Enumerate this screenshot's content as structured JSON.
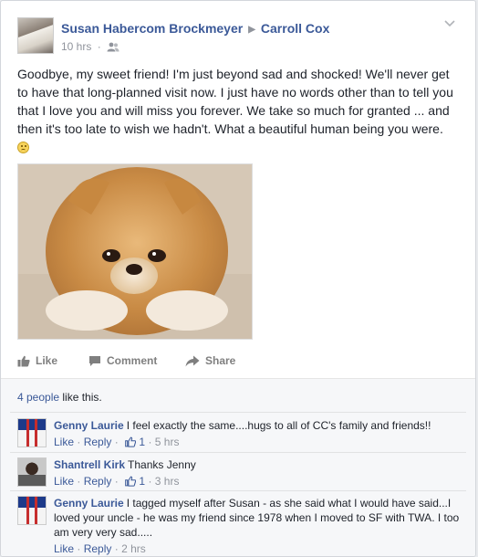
{
  "post": {
    "author": "Susan Habercom Brockmeyer",
    "target": "Carroll Cox",
    "time": "10 hrs",
    "separator": "·",
    "text": "Goodbye, my sweet friend! I'm just beyond sad and shocked! We'll never get to have that long-planned visit now. I just have no words other than to tell you that I love you and will miss you forever. We take so much for granted ... and then it's too late to wish we hadn't. What a beautiful human being you were."
  },
  "actions": {
    "like": "Like",
    "comment": "Comment",
    "share": "Share"
  },
  "likes": {
    "count_link": "4 people",
    "suffix": " like this."
  },
  "comments": [
    {
      "author": "Genny Laurie",
      "text": "I feel exactly the same....hugs to all of CC's family and friends!!",
      "like": "Like",
      "reply": "Reply",
      "likes_count": "1",
      "time": "5 hrs"
    },
    {
      "author": "Shantrell Kirk",
      "text": "Thanks Jenny",
      "like": "Like",
      "reply": "Reply",
      "likes_count": "1",
      "time": "3 hrs"
    },
    {
      "author": "Genny Laurie",
      "text": "I tagged myself after Susan - as she said what I would have said...I loved your uncle - he was my friend since 1978 when I moved to SF with TWA. I too am very very sad.....",
      "like": "Like",
      "reply": "Reply",
      "time": "2 hrs"
    }
  ],
  "meta_separator": "·",
  "colors": {
    "link": "#3b5998",
    "muted": "#90949c",
    "feedback_bg": "#f6f7f9"
  }
}
